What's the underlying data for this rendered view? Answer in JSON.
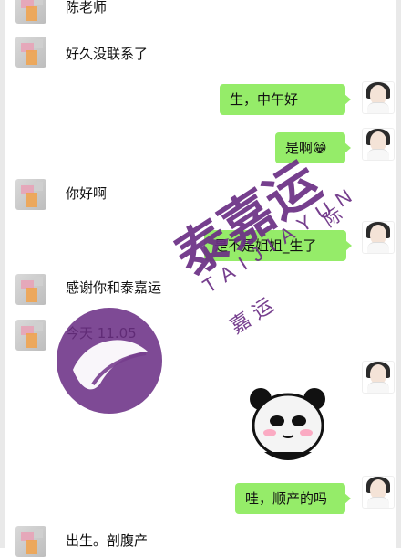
{
  "messages": [
    {
      "id": "m1",
      "side": "in",
      "text": "陈老师"
    },
    {
      "id": "m2",
      "side": "in",
      "text": "好久没联系了"
    },
    {
      "id": "m3",
      "side": "out",
      "text": "生，中午好"
    },
    {
      "id": "m4",
      "side": "out",
      "text": "是啊😁"
    },
    {
      "id": "m5",
      "side": "in",
      "text": "你好啊"
    },
    {
      "id": "m6",
      "side": "out",
      "text": "是不是姐姐_生了"
    },
    {
      "id": "m7",
      "side": "in",
      "text": "感谢你和泰嘉运"
    },
    {
      "id": "m8",
      "side": "in",
      "text": "今天 11.05"
    },
    {
      "id": "m9",
      "side": "out",
      "text": "sticker-panda-face"
    },
    {
      "id": "m10",
      "side": "out",
      "text": "哇，顺产的吗"
    },
    {
      "id": "m11",
      "side": "in",
      "text": "出生。剖腹产"
    }
  ],
  "watermark": {
    "big": "泰嘉运",
    "latin": "TAIJIAYUN",
    "small": "嘉  运",
    "extra": "际"
  },
  "colors": {
    "bubble_out": "#95ec69",
    "bubble_in": "#ffffff",
    "watermark": "#6b2f85"
  },
  "icons": {
    "incoming_avatar": "blurred-avatar",
    "outgoing_avatar": "woman-avatar",
    "watermark_logo": "leaf-logo",
    "sticker": "panda-meme"
  }
}
